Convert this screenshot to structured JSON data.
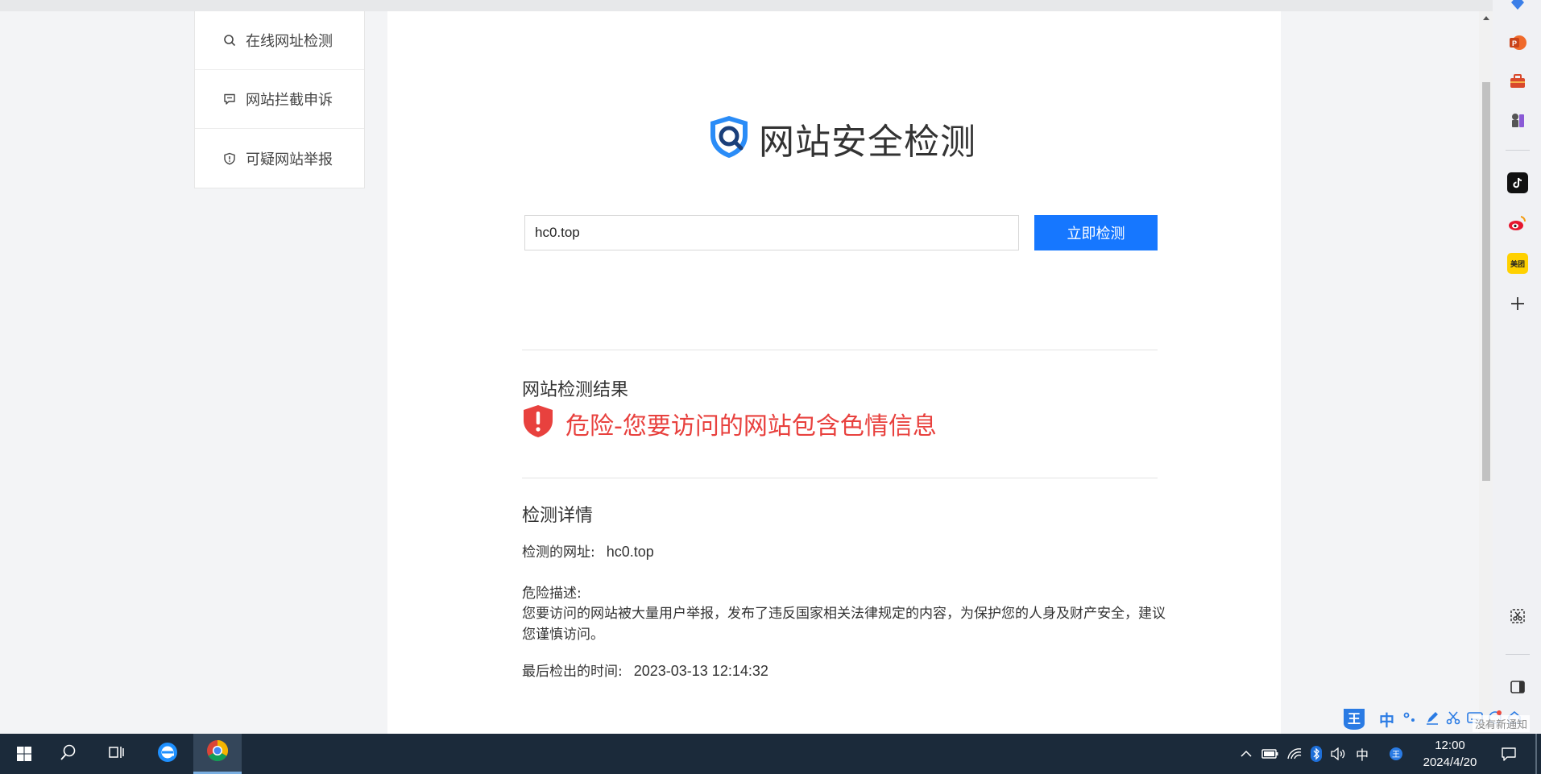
{
  "menu": {
    "items": [
      {
        "label": "在线网址检测",
        "icon": "search-icon"
      },
      {
        "label": "网站拦截申诉",
        "icon": "comment-icon"
      },
      {
        "label": "可疑网站举报",
        "icon": "shield-icon"
      }
    ]
  },
  "header": {
    "title": "网站安全检测"
  },
  "search": {
    "value": "hc0.top",
    "button_label": "立即检测"
  },
  "result": {
    "heading": "网站检测结果",
    "status": "危险-您要访问的网站包含色情信息",
    "status_color": "#e8413e"
  },
  "details": {
    "heading": "检测详情",
    "url_label": "检测的网址:",
    "url_value": "hc0.top",
    "risk_label": "危险描述:",
    "risk_text": "您要访问的网站被大量用户举报，发布了违反国家相关法律规定的内容，为保护您的人身及财产安全，建议您谨慎访问。",
    "time_label": "最后检出的时间:",
    "time_value": "2023-03-13 12:14:32"
  },
  "ime": {
    "mode": "中",
    "toast": "没有新通知"
  },
  "taskbar": {
    "tray_lang": "中",
    "time": "12:00",
    "date": "2024/4/20"
  },
  "colors": {
    "accent": "#1677ff",
    "danger": "#e8413e",
    "taskbar": "#1b2a3a"
  }
}
